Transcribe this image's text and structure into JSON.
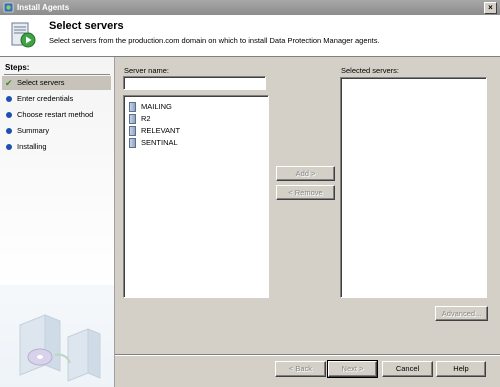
{
  "window": {
    "title": "Install Agents",
    "close_glyph": "×"
  },
  "header": {
    "title": "Select servers",
    "subtitle": "Select servers from the production.com domain on which to install Data Protection Manager agents."
  },
  "steps": {
    "title": "Steps:",
    "items": [
      {
        "label": "Select servers",
        "state": "current"
      },
      {
        "label": "Enter credentials",
        "state": "pending"
      },
      {
        "label": "Choose restart method",
        "state": "pending"
      },
      {
        "label": "Summary",
        "state": "pending"
      },
      {
        "label": "Installing",
        "state": "pending"
      }
    ]
  },
  "server_name": {
    "label": "Server name:",
    "value": ""
  },
  "servers_list": {
    "items": [
      "MAILING",
      "R2",
      "RELEVANT",
      "SENTINAL"
    ]
  },
  "selected_servers": {
    "label": "Selected servers:",
    "items": []
  },
  "buttons": {
    "add": "Add >",
    "remove": "< Remove",
    "advanced": "Advanced...",
    "back": "< Back",
    "next": "Next >",
    "cancel": "Cancel",
    "help": "Help"
  },
  "colors": {
    "step_dot": "#1f4fb3",
    "check": "#3a8a2a"
  }
}
